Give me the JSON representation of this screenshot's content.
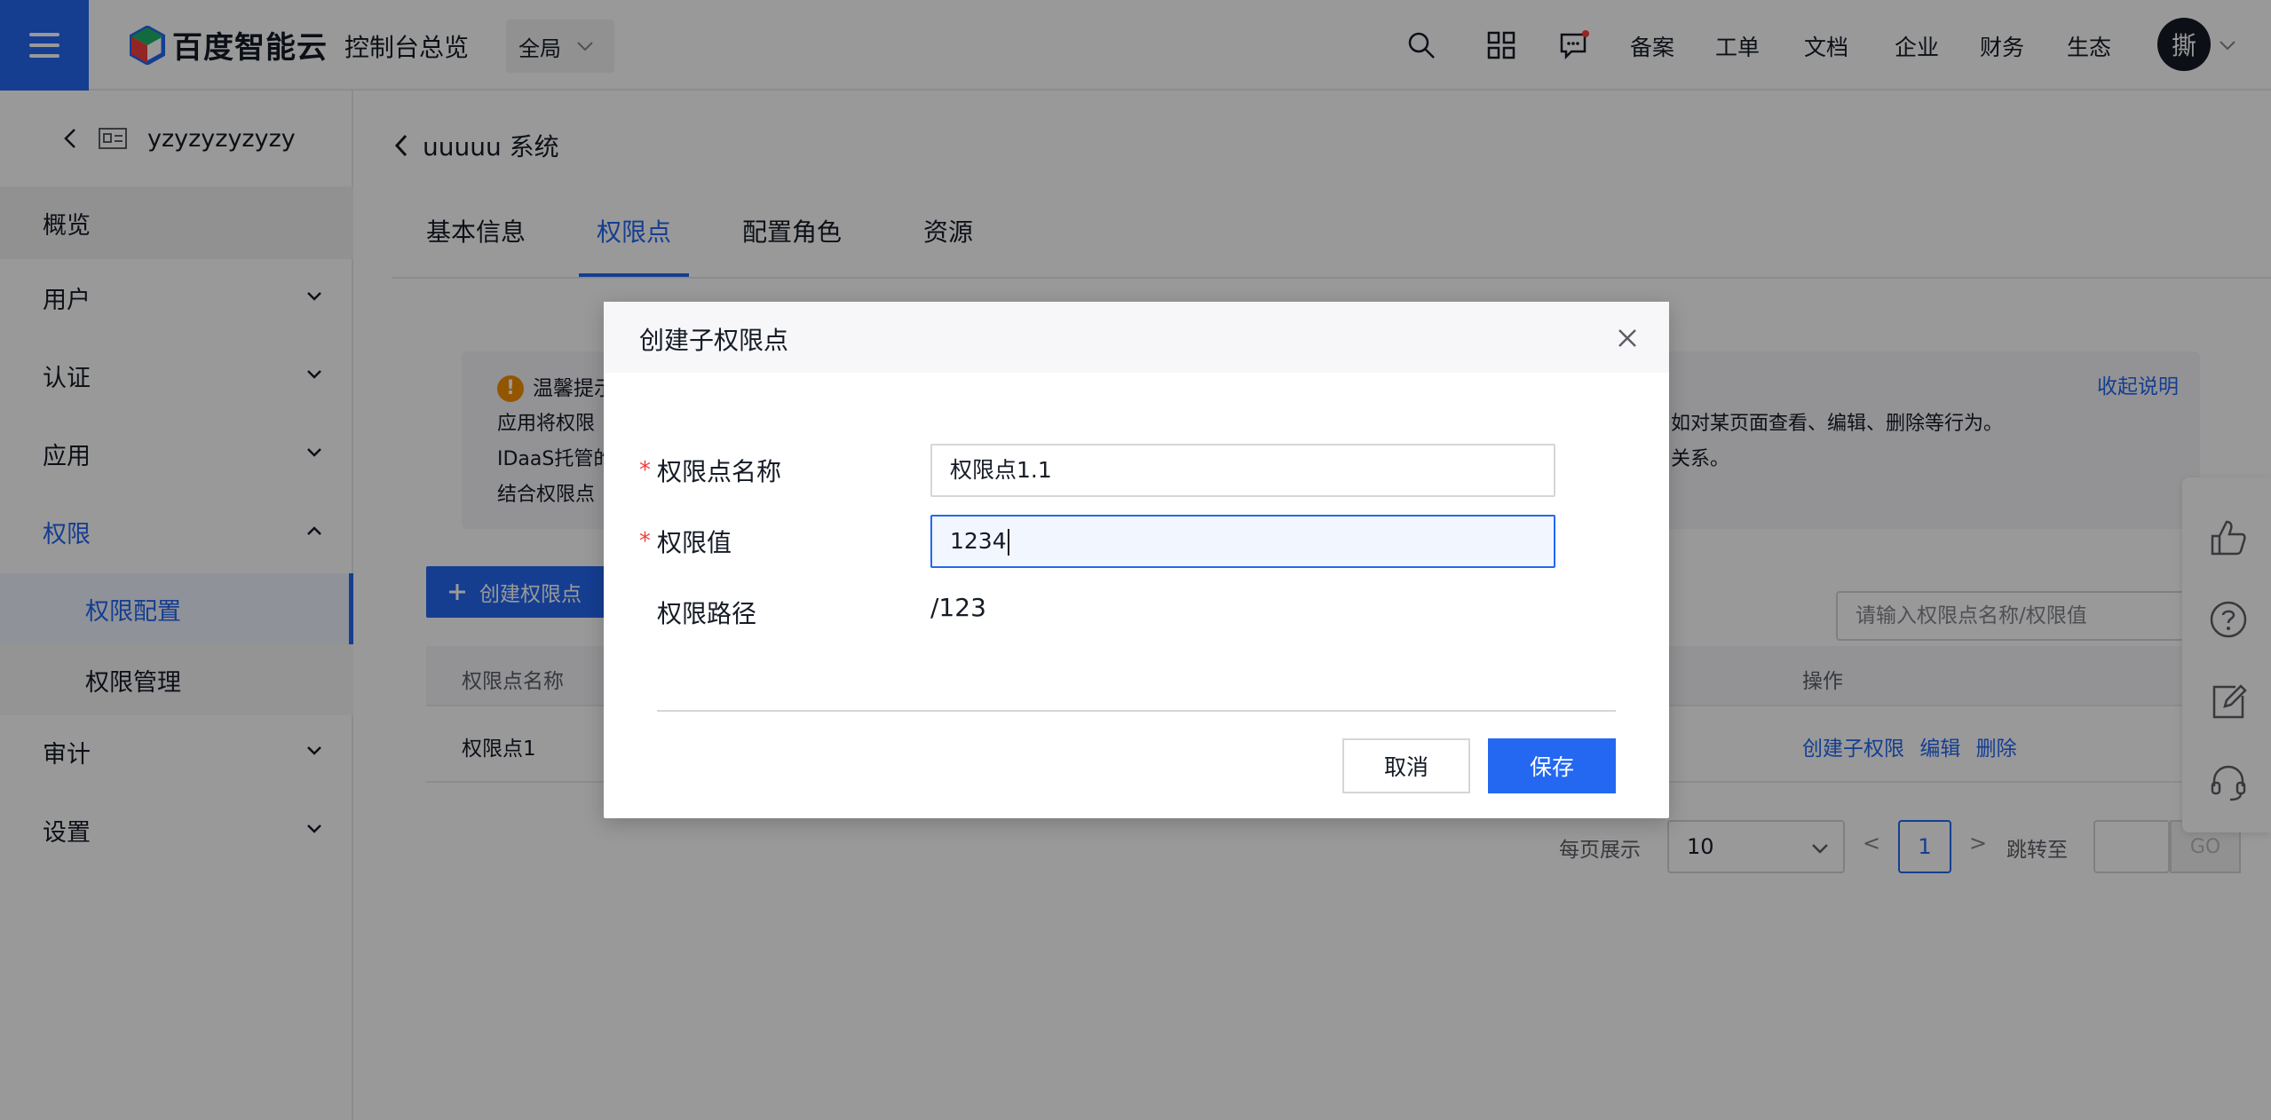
{
  "topbar": {
    "logo_text": "百度智能云",
    "console_title": "控制台总览",
    "region": "全局",
    "links": [
      "备案",
      "工单",
      "文档",
      "企业",
      "财务",
      "生态"
    ],
    "avatar_text": "撕"
  },
  "sidebar": {
    "instance_name": "yzyzyzyzyzy",
    "items": {
      "overview": "概览",
      "users": "用户",
      "auth": "认证",
      "apps": "应用",
      "permissions": "权限",
      "perm_config": "权限配置",
      "perm_manage": "权限管理",
      "audit": "审计",
      "settings": "设置"
    }
  },
  "main": {
    "breadcrumb": "uuuuu 系统",
    "tabs": [
      "基本信息",
      "权限点",
      "配置角色",
      "资源"
    ],
    "active_tab": "权限点",
    "notice": {
      "title": "温馨提示",
      "lines": [
        "应用将权限",
        "IDaaS托管的",
        "结合权限点"
      ],
      "right_lines": [
        "如对某页面查看、编辑、删除等行为。",
        "关系。"
      ],
      "collapse": "收起说明"
    },
    "create_button": "创建权限点",
    "search_placeholder": "请输入权限点名称/权限值",
    "table": {
      "headers": [
        "权限点名称",
        "操作"
      ],
      "rows": [
        {
          "name": "权限点1",
          "ops": [
            "创建子权限",
            "编辑",
            "删除"
          ]
        }
      ]
    },
    "pagination": {
      "per_page_label": "每页展示",
      "per_page": "10",
      "prev": "<",
      "current_page": "1",
      "next": ">",
      "jump_label": "跳转至",
      "go": "GO"
    }
  },
  "modal": {
    "title": "创建子权限点",
    "fields": {
      "name_label": "权限点名称",
      "name_value": "权限点1.1",
      "value_label": "权限值",
      "value_value": "1234",
      "path_label": "权限路径",
      "path_value": "/123"
    },
    "cancel": "取消",
    "save": "保存"
  },
  "colors": {
    "accent": "#2468f2",
    "required": "#f33e3e",
    "warning": "#f39000"
  }
}
